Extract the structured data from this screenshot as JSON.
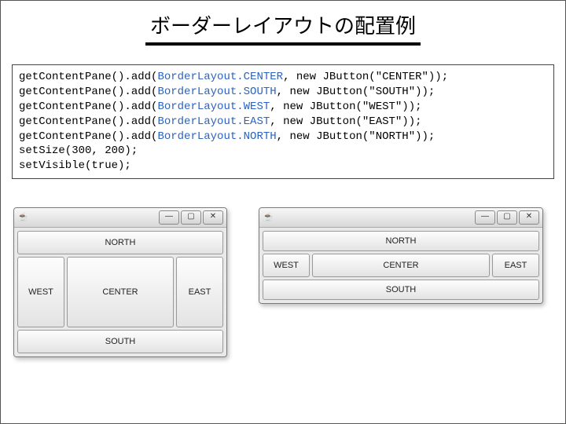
{
  "title": "ボーダーレイアウトの配置例",
  "code": {
    "l1a": "getContentPane().add(",
    "l1b": "BorderLayout.CENTER",
    "l1c": ", new JButton(\"CENTER\"));",
    "l2a": "getContentPane().add(",
    "l2b": "BorderLayout.SOUTH",
    "l2c": ", new JButton(\"SOUTH\"));",
    "l3a": "getContentPane().add(",
    "l3b": "BorderLayout.WEST",
    "l3c": ", new JButton(\"WEST\"));",
    "l4a": "getContentPane().add(",
    "l4b": "BorderLayout.EAST",
    "l4c": ", new JButton(\"EAST\"));",
    "l5a": "getContentPane().add(",
    "l5b": "BorderLayout.NORTH",
    "l5c": ", new JButton(\"NORTH\"));",
    "l6": "setSize(300, 200);",
    "l7": "setVisible(true);"
  },
  "java_icon": "☕",
  "winctl": {
    "min": "—",
    "max": "▢",
    "close": "✕"
  },
  "btn": {
    "north": "NORTH",
    "south": "SOUTH",
    "west": "WEST",
    "east": "EAST",
    "center": "CENTER"
  }
}
